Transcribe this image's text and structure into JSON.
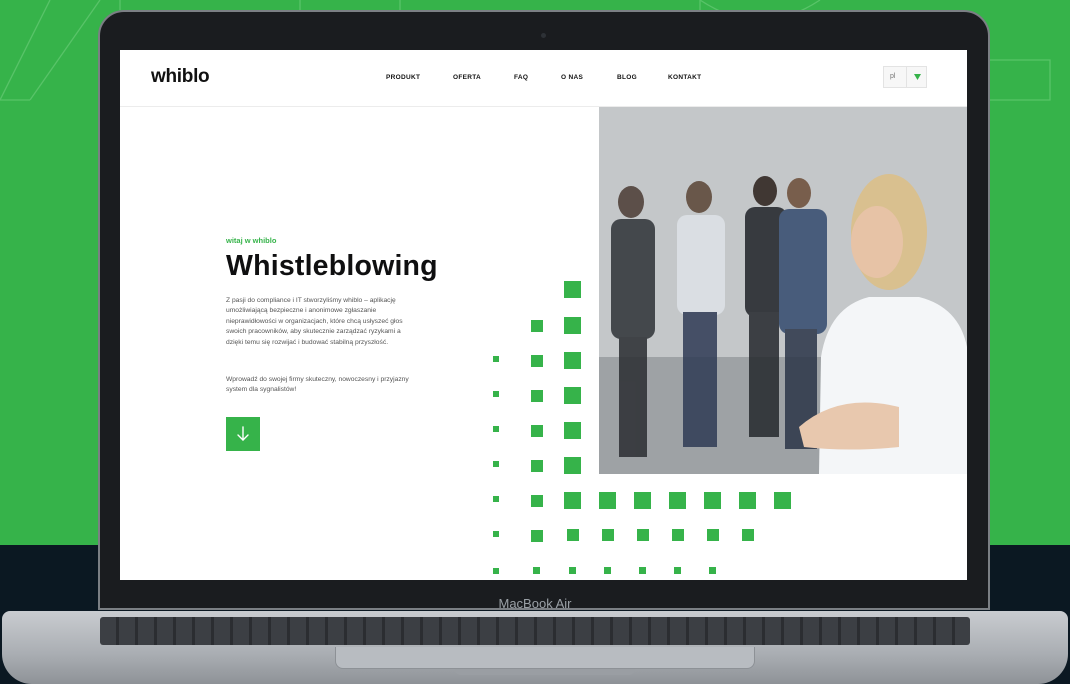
{
  "device": {
    "label": "MacBook Air"
  },
  "site": {
    "logo": "whiblo",
    "nav": [
      "PRODUKT",
      "OFERTA",
      "FAQ",
      "O NAS",
      "BLOG",
      "KONTAKT"
    ],
    "language": {
      "selected": "pl"
    }
  },
  "hero": {
    "eyebrow": "witaj w whiblo",
    "title": "Whistleblowing",
    "paragraph1": "Z pasji do compliance i IT stworzyliśmy whiblo – aplikację umożliwiającą bezpieczne i anonimowe zgłaszanie nieprawidłowości w organizacjach, które chcą usłyszeć głos swoich pracowników, aby skutecznie zarządzać ryzykami a dzięki temu się rozwijać i budować stabilną przyszłość.",
    "paragraph2": "Wprowadź do swojej firmy skuteczny, nowoczesny i przyjazny system dla sygnalistów!",
    "scroll_icon": "arrow-down-icon"
  },
  "colors": {
    "brand_green": "#36b34a",
    "background_dark": "#0b1822",
    "text_dark": "#0f0f10"
  }
}
